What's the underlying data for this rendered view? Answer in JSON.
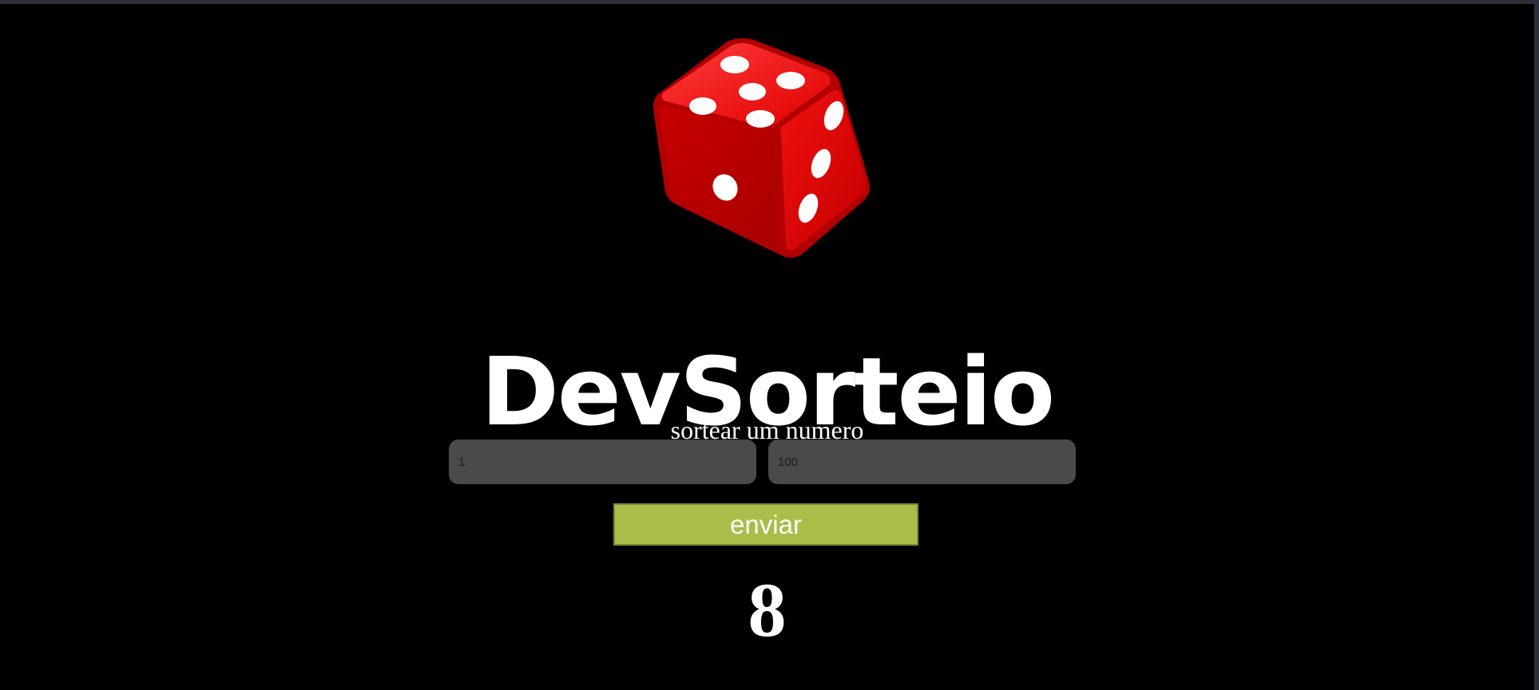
{
  "app": {
    "logo_text": "DevSorteio",
    "subtitle": "sortear um numero",
    "dice_image": "red-dice-icon"
  },
  "form": {
    "min_placeholder": "1",
    "max_placeholder": "100",
    "submit_label": "enviar"
  },
  "result": {
    "value": "8"
  },
  "colors": {
    "background": "#000000",
    "button": "#a9bd48",
    "input": "#4a4a4a",
    "dice": "#e0070c"
  }
}
